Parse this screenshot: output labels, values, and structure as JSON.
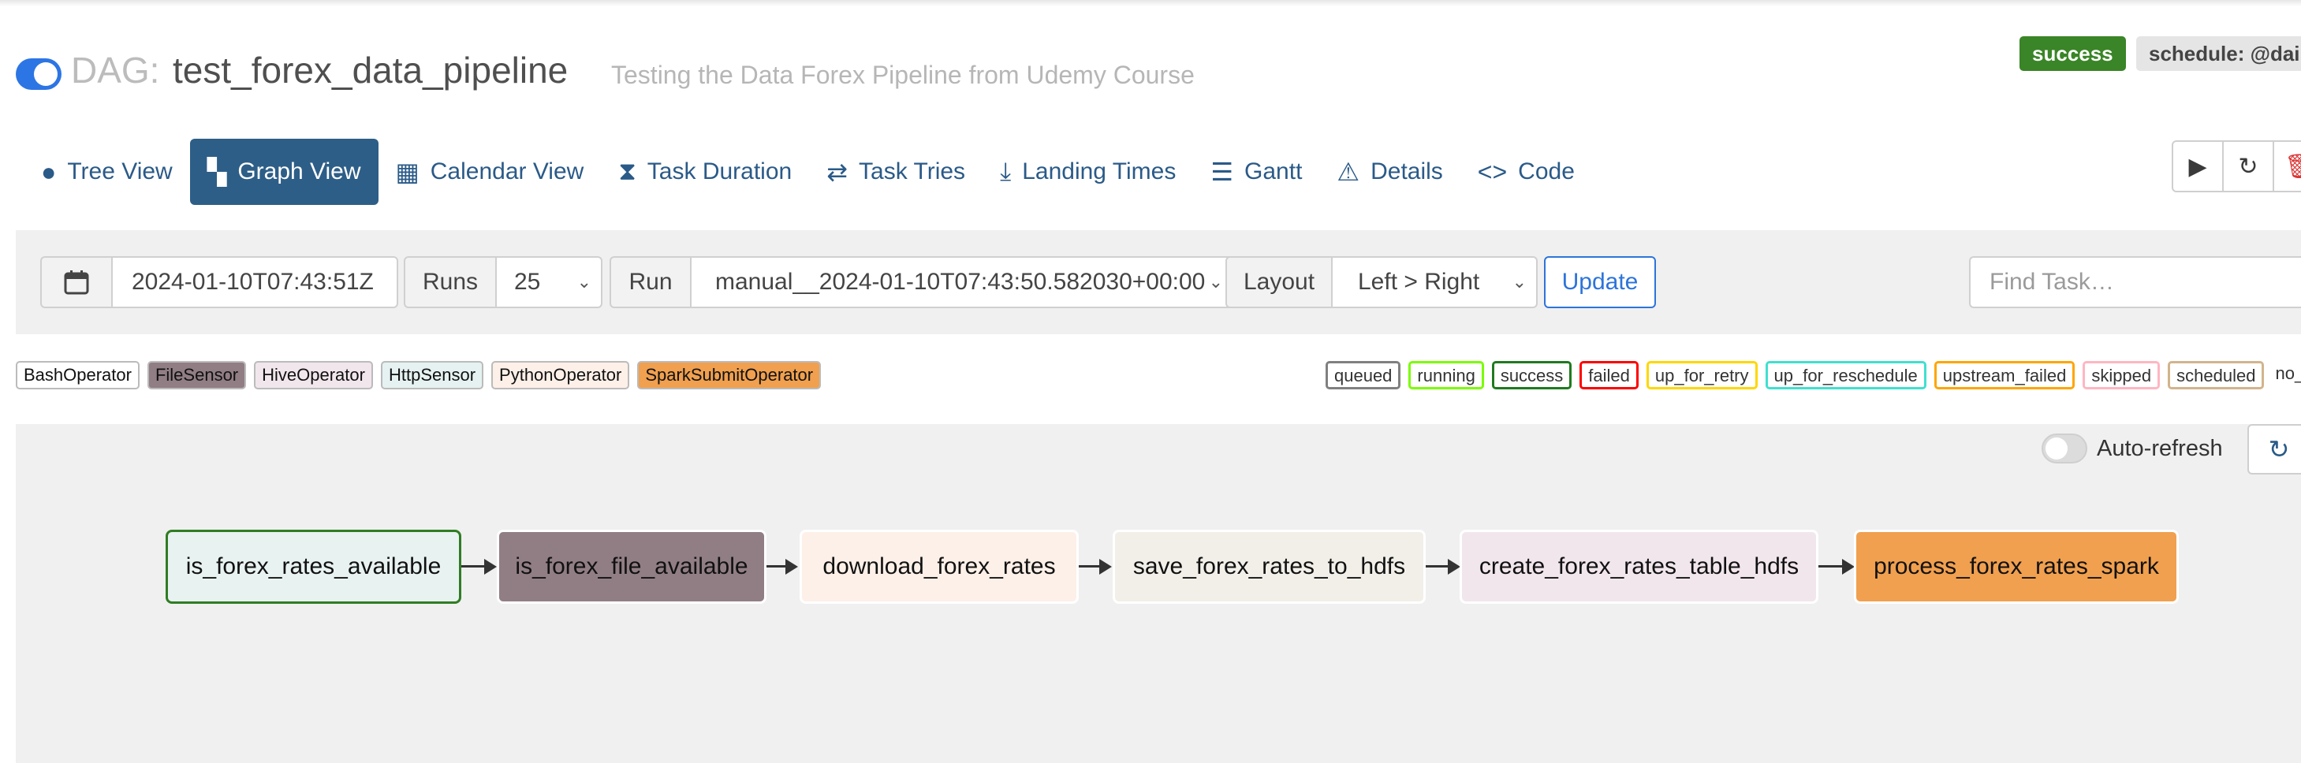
{
  "header": {
    "dag_prefix": "DAG:",
    "dag_id": "test_forex_data_pipeline",
    "description": "Testing the Data Forex Pipeline from Udemy Course",
    "status_badge": "success",
    "schedule_badge": "schedule: @dai"
  },
  "nav": {
    "tabs": [
      {
        "label": "Tree View",
        "icon": "tree-icon",
        "glyph": "●"
      },
      {
        "label": "Graph View",
        "icon": "graph-icon",
        "glyph": "▚"
      },
      {
        "label": "Calendar View",
        "icon": "calendar-icon",
        "glyph": "▦"
      },
      {
        "label": "Task Duration",
        "icon": "hourglass-icon",
        "glyph": "⧗"
      },
      {
        "label": "Task Tries",
        "icon": "retry-icon",
        "glyph": "⇄"
      },
      {
        "label": "Landing Times",
        "icon": "landing-icon",
        "glyph": "⤓"
      },
      {
        "label": "Gantt",
        "icon": "gantt-icon",
        "glyph": "☰"
      },
      {
        "label": "Details",
        "icon": "warning-icon",
        "glyph": "⚠"
      },
      {
        "label": "Code",
        "icon": "code-icon",
        "glyph": "<>"
      }
    ],
    "active_tab": "Graph View"
  },
  "actions": {
    "trigger_glyph": "▶",
    "refresh_glyph": "↻",
    "delete_glyph": "🗑"
  },
  "filters": {
    "execution_date": "2024-01-10T07:43:51Z",
    "runs_label": "Runs",
    "runs_value": "25",
    "run_label": "Run",
    "run_value": "manual__2024-01-10T07:43:50.582030+00:00",
    "layout_label": "Layout",
    "layout_value": "Left > Right",
    "update_label": "Update",
    "find_task_placeholder": "Find Task…"
  },
  "operators": [
    {
      "label": "BashOperator",
      "color": "#ffffff"
    },
    {
      "label": "FileSensor",
      "color": "#917e85"
    },
    {
      "label": "HiveOperator",
      "color": "#f1e6ec"
    },
    {
      "label": "HttpSensor",
      "color": "#e5f2f1"
    },
    {
      "label": "PythonOperator",
      "color": "#fdf0e8"
    },
    {
      "label": "SparkSubmitOperator",
      "color": "#f0a04f"
    }
  ],
  "states": [
    {
      "label": "queued",
      "color": "#808080"
    },
    {
      "label": "running",
      "color": "#7cfc00"
    },
    {
      "label": "success",
      "color": "#1f7a1f"
    },
    {
      "label": "failed",
      "color": "#ff0000"
    },
    {
      "label": "up_for_retry",
      "color": "#ffd700"
    },
    {
      "label": "up_for_reschedule",
      "color": "#40e0d0"
    },
    {
      "label": "upstream_failed",
      "color": "#ffa500"
    },
    {
      "label": "skipped",
      "color": "#ffb6c1"
    },
    {
      "label": "scheduled",
      "color": "#d2b48c"
    },
    {
      "label": "no_sta",
      "color": "none"
    }
  ],
  "graph": {
    "auto_refresh_label": "Auto-refresh",
    "tasks": [
      {
        "id": "is_forex_rates_available",
        "fill": "#e8f2f1",
        "border": "#2f7d23"
      },
      {
        "id": "is_forex_file_available",
        "fill": "#917e85",
        "border": "#ffffff"
      },
      {
        "id": "download_forex_rates",
        "fill": "#fdf0e8",
        "border": "#ffffff"
      },
      {
        "id": "save_forex_rates_to_hdfs",
        "fill": "#f1efe8",
        "border": "#ffffff"
      },
      {
        "id": "create_forex_rates_table_hdfs",
        "fill": "#f1e6ec",
        "border": "#ffffff"
      },
      {
        "id": "process_forex_rates_spark",
        "fill": "#f0a04f",
        "border": "#ffffff"
      }
    ]
  }
}
